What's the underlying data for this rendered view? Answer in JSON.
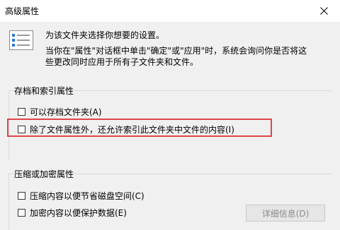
{
  "window": {
    "title": "高级属性"
  },
  "description": {
    "line1": "为该文件夹选择你想要的设置。",
    "line2": "当你在\"属性\"对话框中单击\"确定\"或\"应用\"时，系统会询问你是否将这",
    "line3": "些更改同时应用于所有子文件夹和文件。"
  },
  "archive_index": {
    "label": "存档和索引属性",
    "archive": {
      "label": "可以存档文件夹(A)",
      "checked": false
    },
    "index": {
      "label": "除了文件属性外，还允许索引此文件夹中文件的内容(I)",
      "checked": false
    }
  },
  "compress_encrypt": {
    "label": "压缩或加密属性",
    "compress": {
      "label": "压缩内容以便节省磁盘空间(C)",
      "checked": false
    },
    "encrypt": {
      "label": "加密内容以便保护数据(E)",
      "checked": false
    },
    "details_button": {
      "label": "详细信息(D)",
      "enabled": false
    }
  },
  "highlight_color": "#e0454a"
}
